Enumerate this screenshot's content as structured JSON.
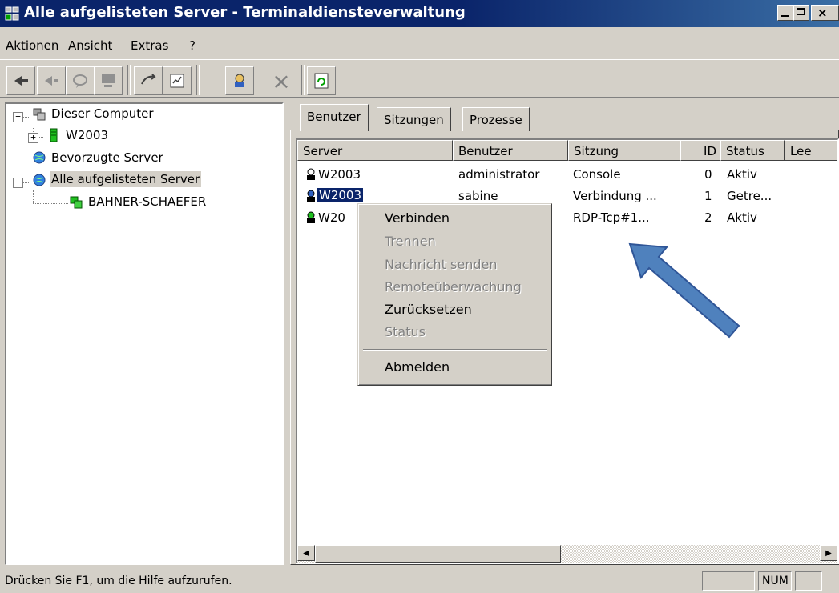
{
  "window": {
    "title": "Alle aufgelisteten Server - Terminaldiensteverwaltung"
  },
  "menu": {
    "items": [
      "Aktionen",
      "Ansicht",
      "Extras",
      "?"
    ]
  },
  "toolbar": {
    "buttons": [
      "connect-icon",
      "disconnect-icon",
      "send-message-icon",
      "remote-control-icon",
      "reset-icon",
      "status-icon",
      "logoff-icon",
      "end-process-icon",
      "refresh-icon"
    ]
  },
  "tree": {
    "nodes": [
      {
        "label": "Dieser Computer"
      },
      {
        "label": "W2003"
      },
      {
        "label": "Bevorzugte Server"
      },
      {
        "label": "Alle aufgelisteten Server"
      },
      {
        "label": "BAHNER-SCHAEFER"
      }
    ],
    "expander_minus": "−",
    "expander_plus": "+"
  },
  "tabs": [
    "Benutzer",
    "Sitzungen",
    "Prozesse"
  ],
  "list": {
    "columns": [
      "Server",
      "Benutzer",
      "Sitzung",
      "ID",
      "Status",
      "Lee"
    ],
    "rows": [
      {
        "server": "W2003",
        "user": "administrator",
        "session": "Console",
        "id": "0",
        "status": "Aktiv"
      },
      {
        "server": "W2003",
        "user": "sabine",
        "session": "Verbindung ...",
        "id": "1",
        "status": "Getre..."
      },
      {
        "server": "W20",
        "user": "",
        "session": "RDP-Tcp#1...",
        "id": "2",
        "status": "Aktiv"
      }
    ]
  },
  "context_menu": {
    "items": [
      {
        "label": "Verbinden",
        "enabled": true
      },
      {
        "label": "Trennen",
        "enabled": false
      },
      {
        "label": "Nachricht senden",
        "enabled": false
      },
      {
        "label": "Remoteüberwachung",
        "enabled": false
      },
      {
        "label": "Zurücksetzen",
        "enabled": true
      },
      {
        "label": "Status",
        "enabled": false
      },
      {
        "label": "Abmelden",
        "enabled": true
      }
    ]
  },
  "statusbar": {
    "text": "Drücken Sie F1, um die Hilfe aufzurufen.",
    "num": "NUM"
  },
  "colors": {
    "titlebar": "#0a246a",
    "selection": "#0a246a",
    "face": "#d4d0c8",
    "arrow": "#4f81bd"
  }
}
